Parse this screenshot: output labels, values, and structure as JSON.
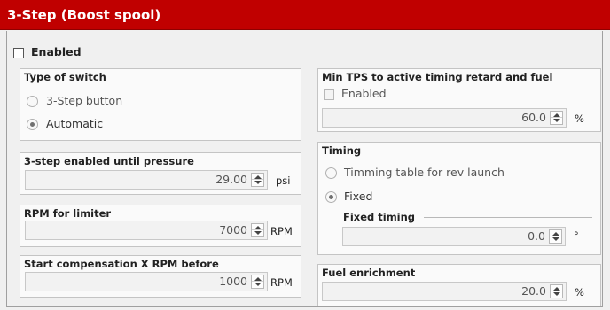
{
  "window": {
    "title": "3-Step (Boost spool)"
  },
  "enabled_label": "Enabled",
  "type_of_switch": {
    "title": "Type of switch",
    "options": [
      "3-Step button",
      "Automatic"
    ],
    "selected": "Automatic"
  },
  "pressure": {
    "title": "3-step enabled until pressure",
    "value": "29.00",
    "unit": "psi"
  },
  "rpm_limiter": {
    "title": "RPM for limiter",
    "value": "7000",
    "unit": "RPM"
  },
  "start_comp": {
    "title": "Start compensation X RPM before",
    "value": "1000",
    "unit": "RPM"
  },
  "min_tps": {
    "title": "Min TPS to active timing retard and fuel",
    "enabled_label": "Enabled",
    "value": "60.0",
    "unit": "%"
  },
  "timing": {
    "title": "Timing",
    "options": [
      "Timming table for rev launch",
      "Fixed"
    ],
    "selected": "Fixed",
    "fixed_title": "Fixed timing",
    "fixed_value": "0.0",
    "fixed_unit": "°"
  },
  "fuel": {
    "title": "Fuel enrichment",
    "value": "20.0",
    "unit": "%"
  }
}
